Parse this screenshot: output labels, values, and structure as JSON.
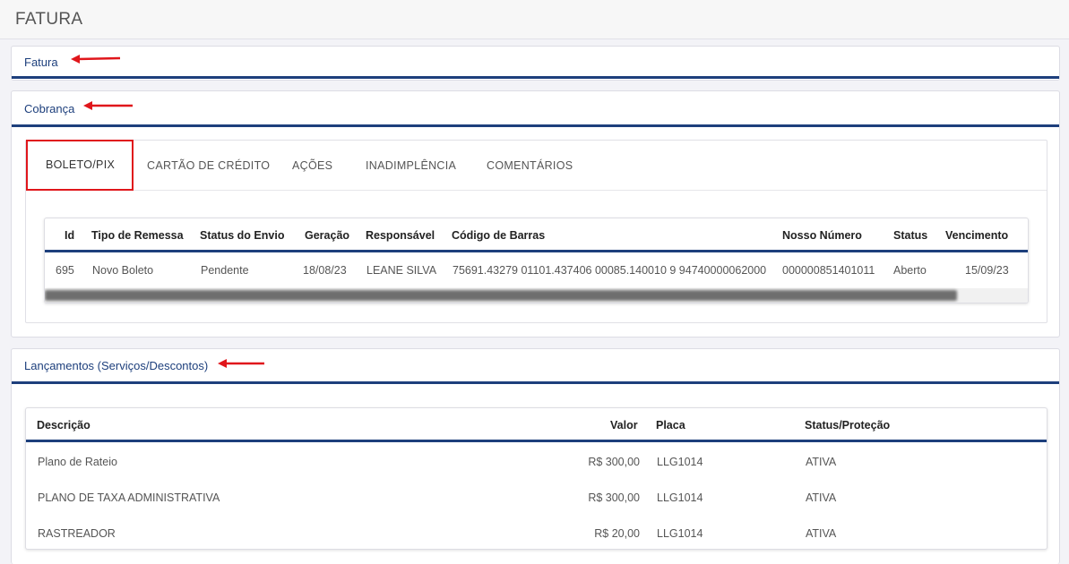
{
  "page": {
    "title": "FATURA"
  },
  "sections": {
    "fatura": {
      "title": "Fatura"
    },
    "cobranca": {
      "title": "Cobrança"
    },
    "lancamentos": {
      "title": "Lançamentos (Serviços/Descontos)"
    }
  },
  "tabs": [
    {
      "label": "BOLETO/PIX",
      "active": true
    },
    {
      "label": "CARTÃO DE CRÉDITO",
      "active": false
    },
    {
      "label": "AÇÕES",
      "active": false
    },
    {
      "label": "INADIMPLÊNCIA",
      "active": false
    },
    {
      "label": "COMENTÁRIOS",
      "active": false
    }
  ],
  "boleto_table": {
    "headers": [
      "Id",
      "Tipo de Remessa",
      "Status do Envio",
      "Geração",
      "Responsável",
      "Código de Barras",
      "Nosso Número",
      "Status",
      "Vencimento"
    ],
    "rows": [
      [
        "695",
        "Novo Boleto",
        "Pendente",
        "18/08/23",
        "LEANE SILVA",
        "75691.43279 01101.437406 00085.140010 9 94740000062000",
        "000000851401011",
        "Aberto",
        "15/09/23"
      ]
    ]
  },
  "lancamentos_table": {
    "headers": [
      "Descrição",
      "Valor",
      "Placa",
      "Status/Proteção"
    ],
    "rows": [
      [
        "Plano de Rateio",
        "R$ 300,00",
        "LLG1014",
        "ATIVA"
      ],
      [
        "PLANO DE TAXA ADMINISTRATIVA",
        "R$ 300,00",
        "LLG1014",
        "ATIVA"
      ],
      [
        "RASTREADOR",
        "R$ 20,00",
        "LLG1014",
        "ATIVA"
      ]
    ]
  },
  "colors": {
    "accent": "#1d3f7c",
    "annotation": "#e0161b"
  }
}
